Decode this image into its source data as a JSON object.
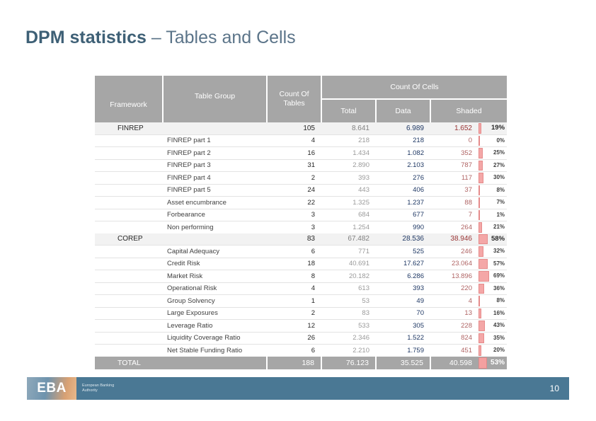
{
  "title": {
    "bold_part": "DPM statistics",
    "light_part": " – Tables and Cells"
  },
  "table": {
    "headers": {
      "framework": "Framework",
      "table_group": "Table Group",
      "count_of_tables": "Count Of Tables",
      "count_of_cells": "Count Of Cells",
      "total": "Total",
      "data": "Data",
      "shaded": "Shaded"
    },
    "rows": [
      {
        "type": "group",
        "framework": "FINREP",
        "group": "",
        "tables": "105",
        "total": "8.641",
        "data": "6.989",
        "shaded": "1.652",
        "pct": "19%",
        "pct_value": 19
      },
      {
        "type": "detail",
        "framework": "",
        "group": "FINREP part 1",
        "tables": "4",
        "total": "218",
        "data": "218",
        "shaded": "0",
        "pct": "0%",
        "pct_value": 0
      },
      {
        "type": "detail",
        "framework": "",
        "group": "FINREP part 2",
        "tables": "16",
        "total": "1.434",
        "data": "1.082",
        "shaded": "352",
        "pct": "25%",
        "pct_value": 25
      },
      {
        "type": "detail",
        "framework": "",
        "group": "FINREP part 3",
        "tables": "31",
        "total": "2.890",
        "data": "2.103",
        "shaded": "787",
        "pct": "27%",
        "pct_value": 27
      },
      {
        "type": "detail",
        "framework": "",
        "group": "FINREP part 4",
        "tables": "2",
        "total": "393",
        "data": "276",
        "shaded": "117",
        "pct": "30%",
        "pct_value": 30
      },
      {
        "type": "detail",
        "framework": "",
        "group": "FINREP part 5",
        "tables": "24",
        "total": "443",
        "data": "406",
        "shaded": "37",
        "pct": "8%",
        "pct_value": 8
      },
      {
        "type": "detail",
        "framework": "",
        "group": "Asset encumbrance",
        "tables": "22",
        "total": "1.325",
        "data": "1.237",
        "shaded": "88",
        "pct": "7%",
        "pct_value": 7
      },
      {
        "type": "detail",
        "framework": "",
        "group": "Forbearance",
        "tables": "3",
        "total": "684",
        "data": "677",
        "shaded": "7",
        "pct": "1%",
        "pct_value": 1
      },
      {
        "type": "detail",
        "framework": "",
        "group": "Non performing",
        "tables": "3",
        "total": "1.254",
        "data": "990",
        "shaded": "264",
        "pct": "21%",
        "pct_value": 21
      },
      {
        "type": "group",
        "framework": "COREP",
        "group": "",
        "tables": "83",
        "total": "67.482",
        "data": "28.536",
        "shaded": "38.946",
        "pct": "58%",
        "pct_value": 58
      },
      {
        "type": "detail",
        "framework": "",
        "group": "Capital Adequacy",
        "tables": "6",
        "total": "771",
        "data": "525",
        "shaded": "246",
        "pct": "32%",
        "pct_value": 32
      },
      {
        "type": "detail",
        "framework": "",
        "group": "Credit Risk",
        "tables": "18",
        "total": "40.691",
        "data": "17.627",
        "shaded": "23.064",
        "pct": "57%",
        "pct_value": 57
      },
      {
        "type": "detail",
        "framework": "",
        "group": "Market Risk",
        "tables": "8",
        "total": "20.182",
        "data": "6.286",
        "shaded": "13.896",
        "pct": "69%",
        "pct_value": 69
      },
      {
        "type": "detail",
        "framework": "",
        "group": "Operational Risk",
        "tables": "4",
        "total": "613",
        "data": "393",
        "shaded": "220",
        "pct": "36%",
        "pct_value": 36
      },
      {
        "type": "detail",
        "framework": "",
        "group": "Group Solvency",
        "tables": "1",
        "total": "53",
        "data": "49",
        "shaded": "4",
        "pct": "8%",
        "pct_value": 8
      },
      {
        "type": "detail",
        "framework": "",
        "group": "Large Exposures",
        "tables": "2",
        "total": "83",
        "data": "70",
        "shaded": "13",
        "pct": "16%",
        "pct_value": 16
      },
      {
        "type": "detail",
        "framework": "",
        "group": "Leverage Ratio",
        "tables": "12",
        "total": "533",
        "data": "305",
        "shaded": "228",
        "pct": "43%",
        "pct_value": 43
      },
      {
        "type": "detail",
        "framework": "",
        "group": "Liquidity Coverage Ratio",
        "tables": "26",
        "total": "2.346",
        "data": "1.522",
        "shaded": "824",
        "pct": "35%",
        "pct_value": 35
      },
      {
        "type": "detail",
        "framework": "",
        "group": "Net Stable Funding Ratio",
        "tables": "6",
        "total": "2.210",
        "data": "1.759",
        "shaded": "451",
        "pct": "20%",
        "pct_value": 20
      },
      {
        "type": "total",
        "framework": "TOTAL",
        "group": "",
        "tables": "188",
        "total": "76.123",
        "data": "35.525",
        "shaded": "40.598",
        "pct": "53%",
        "pct_value": 53
      }
    ]
  },
  "footer": {
    "logo_text": "EBA",
    "logo_subtitle": "European Banking Authority",
    "page_number": "10"
  },
  "colors": {
    "title_accent": "#3e6076",
    "header_gray": "#a6a6a6",
    "group_row": "#f2f2f2",
    "data_blue": "#1f3864",
    "shaded_red": "#a03a3a",
    "bar_pink": "#f4a7a7",
    "footer_blue": "#4a7894"
  }
}
